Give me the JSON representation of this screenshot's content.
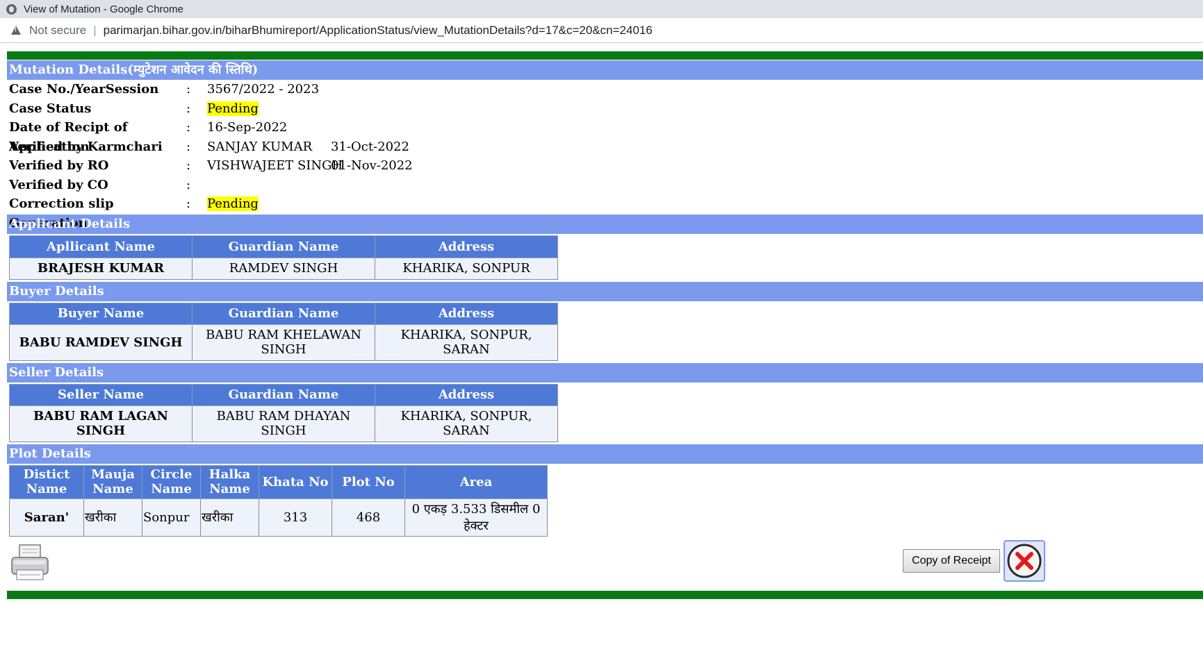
{
  "window": {
    "title": "View of Mutation - Google Chrome",
    "security": "Not secure",
    "url": "parimarjan.bihar.gov.in/biharBhumireport/ApplicationStatus/view_MutationDetails?d=17&c=20&cn=24016"
  },
  "mutation": {
    "heading": "Mutation Details(म्युटेशन आवेदन की स्तिथि)",
    "rows": [
      {
        "label": "Case No./YearSession",
        "colon": ":",
        "value": "3567/2022 - 2023",
        "extra": ""
      },
      {
        "label": "Case Status",
        "colon": ":",
        "value": "Pending",
        "extra": ""
      },
      {
        "label": "Date of Recipt of Application",
        "colon": ":",
        "value": "16-Sep-2022",
        "extra": ""
      },
      {
        "label": "Verified by Karmchari",
        "colon": ":",
        "value": "SANJAY KUMAR",
        "extra": "31-Oct-2022"
      },
      {
        "label": "Verified by RO",
        "colon": ":",
        "value": "VISHWAJEET SINGH",
        "extra": "01-Nov-2022"
      },
      {
        "label": "Verified by CO",
        "colon": ":",
        "value": "",
        "extra": ""
      },
      {
        "label": "Correction slip Generation",
        "colon": ":",
        "value": "Pending",
        "extra": ""
      }
    ]
  },
  "applicant": {
    "heading": "Applicant Details",
    "headers": [
      "Apllicant Name",
      "Guardian Name",
      "Address"
    ],
    "row": [
      "BRAJESH KUMAR",
      "RAMDEV SINGH",
      "KHARIKA, SONPUR"
    ]
  },
  "buyer": {
    "heading": "Buyer Details",
    "headers": [
      "Buyer Name",
      "Guardian Name",
      "Address"
    ],
    "row": [
      "BABU RAMDEV SINGH",
      "BABU RAM KHELAWAN SINGH",
      "KHARIKA, SONPUR, SARAN"
    ]
  },
  "seller": {
    "heading": "Seller Details",
    "headers": [
      "Seller Name",
      "Guardian Name",
      "Address"
    ],
    "row": [
      "BABU RAM LAGAN SINGH",
      "BABU RAM DHAYAN SINGH",
      "KHARIKA, SONPUR, SARAN"
    ]
  },
  "plot": {
    "heading": "Plot Details",
    "headers": [
      "Distict Name",
      "Mauja Name",
      "Circle Name",
      "Halka Name",
      "Khata No",
      "Plot No",
      "Area"
    ],
    "row": [
      "Saran'",
      "खरीका",
      "Sonpur",
      "खरीका",
      "313",
      "468",
      "0 एकड़ 3.533 डिसमील 0 हेक्टर"
    ]
  },
  "actions": {
    "copy_receipt": "Copy of Receipt",
    "print_icon": "printer-icon",
    "close_icon": "close-x-icon"
  },
  "colors": {
    "green_bar": "#0a7a14",
    "section_header": "#7b9aee",
    "table_header": "#4e79d6",
    "highlight": "#ffff00"
  }
}
